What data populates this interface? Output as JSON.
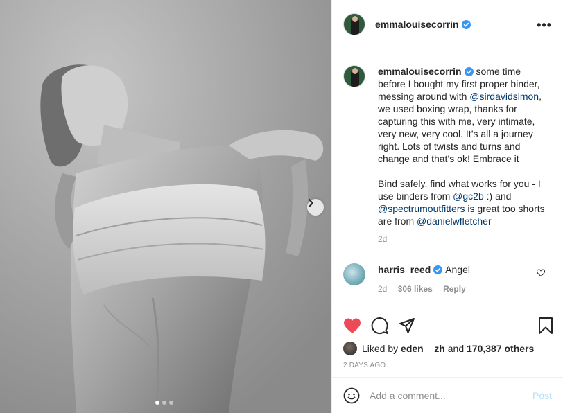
{
  "post": {
    "username": "emmalouisecorrin",
    "verified": true,
    "more_icon": "more-horizontal-icon",
    "carousel": {
      "active_index": 0,
      "count": 3
    }
  },
  "caption": {
    "username": "emmalouisecorrin",
    "part1": " some time before I bought my first proper binder, messing around with ",
    "mention1": "@sirdavidsimon",
    "part2": ", we used boxing wrap, thanks for capturing this with me, very intimate, very new, very cool. It’s all a journey right. Lots of twists and turns and change and that’s ok! Embrace it",
    "part3": "Bind safely, find what works for you - I use binders from ",
    "mention2": "@gc2b",
    "part4": " :) and ",
    "mention3": "@spectrumoutfitters",
    "part5": " is great too shorts are from ",
    "mention4": "@danielwfletcher",
    "time": "2d"
  },
  "comments": [
    {
      "username": "harris_reed",
      "verified": true,
      "text": "Angel",
      "time": "2d",
      "likes": "306 likes",
      "reply": "Reply"
    }
  ],
  "actions": {
    "like_icon": "heart-filled-icon",
    "comment_icon": "comment-icon",
    "share_icon": "share-icon",
    "save_icon": "bookmark-icon",
    "like_color": "#ed4956"
  },
  "likes": {
    "prefix": "Liked by ",
    "user": "eden__zh",
    "middle": " and ",
    "count": "170,387 others"
  },
  "date": "2 DAYS AGO",
  "add_comment": {
    "emoji_icon": "emoji-icon",
    "placeholder": "Add a comment...",
    "post_label": "Post"
  }
}
